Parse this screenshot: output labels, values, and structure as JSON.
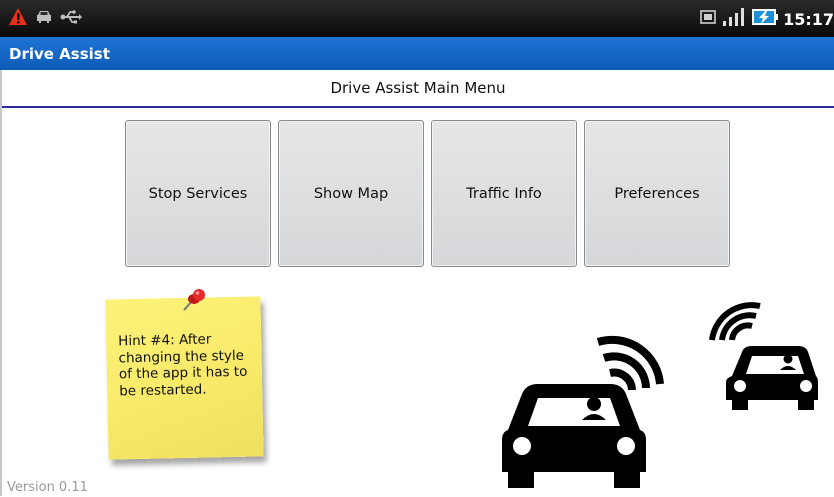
{
  "status_bar": {
    "left_icons": [
      "warning-icon",
      "car-icon",
      "usb-icon"
    ],
    "right_icons": [
      "sim-icon",
      "signal-icon",
      "battery-charging-icon"
    ],
    "time": "15:17"
  },
  "app": {
    "title": "Drive Assist"
  },
  "main": {
    "menu_title": "Drive Assist Main Menu",
    "buttons": [
      {
        "label": "Stop Services"
      },
      {
        "label": "Show Map"
      },
      {
        "label": "Traffic Info"
      },
      {
        "label": "Preferences"
      }
    ]
  },
  "hint": {
    "text": "Hint #4: After changing the style of the app it has to be restarted."
  },
  "footer": {
    "version": "Version 0.11"
  },
  "colors": {
    "title_bar": "#1467c8",
    "header_rule": "#2b2b9c",
    "note": "#f8ea68",
    "pin": "#e02020"
  }
}
